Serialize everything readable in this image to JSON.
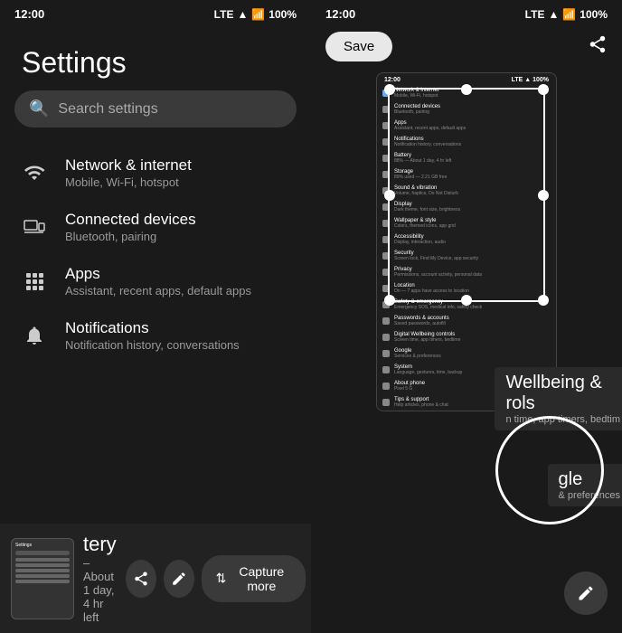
{
  "left": {
    "status": {
      "time": "12:00",
      "network": "LTE",
      "battery": "100%"
    },
    "title": "Settings",
    "search_placeholder": "Search settings",
    "items": [
      {
        "id": "network",
        "icon": "wifi",
        "title": "Network & internet",
        "sub": "Mobile, Wi-Fi, hotspot"
      },
      {
        "id": "devices",
        "icon": "devices",
        "title": "Connected devices",
        "sub": "Bluetooth, pairing"
      },
      {
        "id": "apps",
        "icon": "apps",
        "title": "Apps",
        "sub": "Assistant, recent apps, default apps"
      },
      {
        "id": "notifications",
        "icon": "bell",
        "title": "Notifications",
        "sub": "Notification history, conversations"
      }
    ],
    "partial_item": {
      "title": "tery",
      "sub": "– About 1 day, 4 hr left"
    },
    "bottom_actions": {
      "share_label": "⬆",
      "edit_label": "✎",
      "capture_label": "Capture more",
      "capture_icon": "⇅"
    }
  },
  "right": {
    "status": {
      "time": "12:00",
      "network": "LTE",
      "battery": "100%"
    },
    "toolbar": {
      "save_label": "Save",
      "share_label": "share"
    },
    "mini_items": [
      {
        "title": "Network & internet",
        "sub": "Mobile, Wi-Fi, hotspot"
      },
      {
        "title": "Connected devices",
        "sub": "Bluetooth, pairing"
      },
      {
        "title": "Apps",
        "sub": "Assistant, recent apps, default apps"
      },
      {
        "title": "Notifications",
        "sub": "Notification history, conversations"
      },
      {
        "title": "Battery",
        "sub": "88% — About 1 day, 4 hr left"
      },
      {
        "title": "Storage",
        "sub": "89% used — 2.21 GB free"
      },
      {
        "title": "Sound & vibration",
        "sub": "Volume, haptics, Do Not Disturb"
      },
      {
        "title": "Display",
        "sub": "Dark theme, font size, brightness"
      },
      {
        "title": "Wallpaper & style",
        "sub": "Colors, themed icons, app grid"
      },
      {
        "title": "Accessibility",
        "sub": "Display, interaction, audio"
      },
      {
        "title": "Security",
        "sub": "Screen lock, Find My Device, app security"
      },
      {
        "title": "Privacy",
        "sub": "Permissions, account activity, personal data"
      },
      {
        "title": "Location",
        "sub": "On — 7 apps have access to location"
      },
      {
        "title": "Safety & emergency",
        "sub": "Emergency SOS, medical info, safety check"
      },
      {
        "title": "Passwords & accounts",
        "sub": "Saved passwords, autofill"
      },
      {
        "title": "Digital Wellbeing & controls",
        "sub": "Screen time, app timers, bedtime"
      },
      {
        "title": "Google",
        "sub": "Services & preferences"
      },
      {
        "title": "System",
        "sub": "Language, gestures, time, backup"
      },
      {
        "title": "About phone",
        "sub": "Pixel 5 G"
      },
      {
        "title": "Tips & support",
        "sub": "Help articles, phone & chat"
      }
    ],
    "zoom_overlays": {
      "wellbeing": "Wellbeing &\nrols",
      "sub_wellbeing": "n time, app timers, bedtim",
      "google": "gle",
      "sub_google": "& preferences"
    },
    "edit_label": "✎"
  }
}
